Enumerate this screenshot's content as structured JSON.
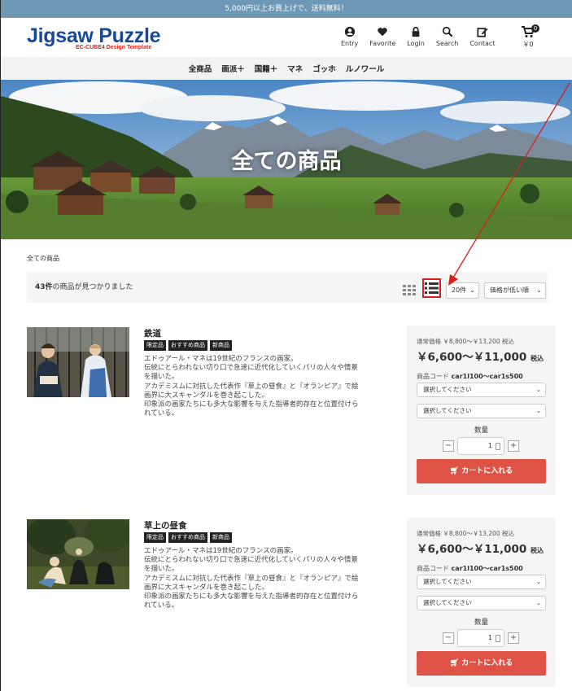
{
  "topbar": {
    "notice": "5,000円以上お買上げで、送料無料！"
  },
  "brand": {
    "name": "Jigsaw Puzzle",
    "subtitle": "EC-CUBE4 Design Template",
    "title_color": "#17489a",
    "subtitle_color": "#d9281c"
  },
  "header_icons": [
    {
      "icon": "user-circle-icon",
      "label": "Entry"
    },
    {
      "icon": "heart-icon",
      "label": "Favorite"
    },
    {
      "icon": "lock-icon",
      "label": "Login"
    },
    {
      "icon": "search-icon",
      "label": "Search"
    },
    {
      "icon": "edit-icon",
      "label": "Contact"
    }
  ],
  "cart": {
    "icon": "cart-icon",
    "count": "0",
    "total": "￥0"
  },
  "nav": [
    "全商品",
    "画派＋",
    "国籍＋",
    "マネ",
    "ゴッホ",
    "ルノワール"
  ],
  "hero": {
    "title": "全ての商品"
  },
  "breadcrumb": "全ての商品",
  "results": {
    "count": "43件",
    "suffix": "の商品が見つかりました",
    "per_page": "20件",
    "sort": "価格が低い順"
  },
  "view_toggle": {
    "grid_icon": "grid-view-icon",
    "list_icon": "list-view-icon",
    "active": "list",
    "highlight_color": "#d32121"
  },
  "products": [
    {
      "name": "鉄道",
      "tags": [
        "限定品",
        "おすすめ商品",
        "新商品"
      ],
      "description": [
        "エドゥアール・マネは19世紀のフランスの画家。",
        "伝統にとらわれない切り口で急速に近代化していくパリの人々や情景",
        "を描いた。",
        "アカデミスムに対抗した代表作『草上の昼食』と『オランピア』で絵",
        "画界に大スキャンダルを巻き起こした。",
        "印象派の画家たちにも多大な影響を与えた指導者的存在と位置付けら",
        "れている。"
      ],
      "normal_price": "通常価格 ￥8,800～￥13,200 税込",
      "price": "￥6,600～￥11,000",
      "tax": "税込",
      "code_label": "商品コード",
      "code": "car1l100～car1s500",
      "select1": "選択してください",
      "select2": "選択してください",
      "qty_label": "数量",
      "qty": "1",
      "add_to_cart": "カートに入れる"
    },
    {
      "name": "草上の昼食",
      "tags": [
        "限定品",
        "おすすめ商品",
        "新商品"
      ],
      "description": [
        "エドゥアール・マネは19世紀のフランスの画家。",
        "伝統にとらわれない切り口で急速に近代化していくパリの人々や情景",
        "を描いた。",
        "アカデミスムに対抗した代表作『草上の昼食』と『オランピア』で絵",
        "画界に大スキャンダルを巻き起こした。",
        "印象派の画家たちにも多大な影響を与えた指導者的存在と位置付けら",
        "れている。"
      ],
      "normal_price": "通常価格 ￥8,800～￥13,200 税込",
      "price": "￥6,600～￥11,000",
      "tax": "税込",
      "code_label": "商品コード",
      "code": "car1l100～car1s500",
      "select1": "選択してください",
      "select2": "選択してください",
      "qty_label": "数量",
      "qty": "1",
      "add_to_cart": "カートに入れる"
    }
  ]
}
